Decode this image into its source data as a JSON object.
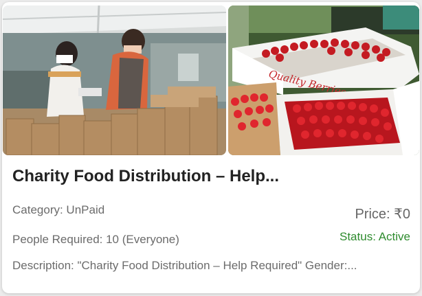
{
  "card": {
    "title": "Charity Food Distribution – Help...",
    "category": "Category: UnPaid",
    "price": "Price: ₹0",
    "people_required": "People Required: 10 (Everyone)",
    "status": "Status: Active",
    "description": "Description: \"Charity Food Distribution – Help Required\" Gender:...",
    "status_color": "#2e8b2e"
  },
  "photos": {
    "right_box_text": "Quality Berries"
  }
}
